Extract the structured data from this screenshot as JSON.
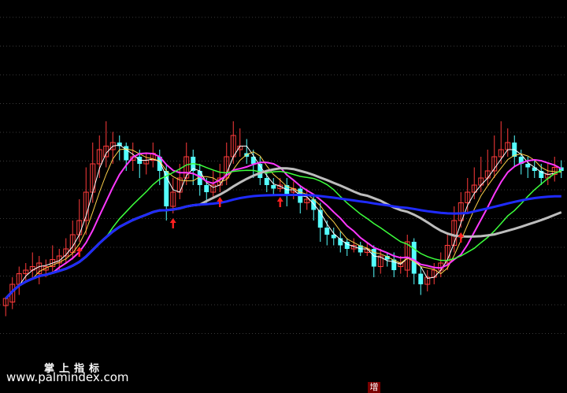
{
  "watermark": {
    "cn": "掌上指标",
    "url": "www.palmindex.com"
  },
  "badge": "增",
  "chart_data": {
    "type": "candlestick",
    "grid": "dotted-horizontal",
    "ylim": [
      0,
      100
    ],
    "candles": [
      [
        16,
        18,
        18,
        13
      ],
      [
        17,
        22,
        24,
        15
      ],
      [
        22,
        25,
        27,
        19
      ],
      [
        25,
        26,
        28,
        23
      ],
      [
        26,
        27,
        31,
        24
      ],
      [
        25,
        28,
        30,
        22
      ],
      [
        26,
        27,
        29,
        24
      ],
      [
        27,
        29,
        33,
        25
      ],
      [
        28,
        30,
        32,
        26
      ],
      [
        30,
        32,
        35,
        28
      ],
      [
        31,
        36,
        40,
        29
      ],
      [
        36,
        40,
        46,
        34
      ],
      [
        40,
        48,
        55,
        36
      ],
      [
        48,
        56,
        62,
        45
      ],
      [
        56,
        60,
        64,
        52
      ],
      [
        58,
        61,
        68,
        55
      ],
      [
        60,
        62,
        65,
        56
      ],
      [
        62,
        61,
        64,
        57
      ],
      [
        61,
        57,
        62,
        54
      ],
      [
        57,
        58,
        62,
        54
      ],
      [
        58,
        56,
        60,
        52
      ],
      [
        56,
        57,
        59,
        53
      ],
      [
        57,
        59,
        62,
        55
      ],
      [
        58,
        54,
        60,
        50
      ],
      [
        54,
        44,
        56,
        40
      ],
      [
        44,
        48,
        52,
        42
      ],
      [
        48,
        52,
        56,
        46
      ],
      [
        52,
        58,
        62,
        50
      ],
      [
        58,
        54,
        60,
        50
      ],
      [
        54,
        50,
        56,
        47
      ],
      [
        50,
        48,
        52,
        45
      ],
      [
        48,
        50,
        54,
        46
      ],
      [
        50,
        52,
        56,
        48
      ],
      [
        52,
        58,
        62,
        50
      ],
      [
        58,
        64,
        68,
        56
      ],
      [
        60,
        61,
        66,
        58
      ],
      [
        59,
        58,
        63,
        56
      ],
      [
        58,
        56,
        60,
        52
      ],
      [
        56,
        52,
        58,
        50
      ],
      [
        52,
        50,
        54,
        48
      ],
      [
        50,
        49,
        52,
        47
      ],
      [
        49,
        50,
        52,
        48
      ],
      [
        50,
        47,
        52,
        44
      ],
      [
        48,
        49,
        51,
        46
      ],
      [
        49,
        45,
        50,
        42
      ],
      [
        45,
        46,
        49,
        43
      ],
      [
        46,
        43,
        47,
        40
      ],
      [
        43,
        38,
        45,
        34
      ],
      [
        38,
        36,
        40,
        33
      ],
      [
        36,
        35,
        38,
        33
      ],
      [
        35,
        33,
        37,
        31
      ],
      [
        34,
        32,
        35,
        30
      ],
      [
        32,
        33,
        35,
        31
      ],
      [
        33,
        31,
        34,
        30
      ],
      [
        31,
        32,
        34,
        30
      ],
      [
        32,
        27,
        33,
        24
      ],
      [
        27,
        30,
        32,
        25
      ],
      [
        30,
        29,
        31,
        27
      ],
      [
        29,
        26,
        31,
        24
      ],
      [
        27,
        28,
        30,
        25
      ],
      [
        26,
        34,
        36,
        24
      ],
      [
        34,
        25,
        35,
        22
      ],
      [
        25,
        22,
        27,
        19
      ],
      [
        22,
        24,
        26,
        20
      ],
      [
        24,
        26,
        28,
        22
      ],
      [
        26,
        28,
        31,
        24
      ],
      [
        28,
        33,
        36,
        26
      ],
      [
        33,
        40,
        44,
        31
      ],
      [
        40,
        45,
        48,
        38
      ],
      [
        45,
        48,
        52,
        42
      ],
      [
        48,
        50,
        55,
        46
      ],
      [
        50,
        52,
        58,
        48
      ],
      [
        52,
        54,
        60,
        50
      ],
      [
        54,
        58,
        64,
        52
      ],
      [
        58,
        60,
        68,
        56
      ],
      [
        60,
        62,
        66,
        58
      ],
      [
        62,
        58,
        64,
        55
      ],
      [
        58,
        56,
        60,
        53
      ],
      [
        56,
        55,
        58,
        52
      ],
      [
        55,
        54,
        57,
        52
      ],
      [
        54,
        52,
        56,
        50
      ],
      [
        52,
        53,
        56,
        50
      ],
      [
        53,
        55,
        58,
        51
      ],
      [
        55,
        54,
        57,
        52
      ]
    ],
    "buy_signals": [
      15,
      36,
      45,
      58,
      97
    ]
  }
}
